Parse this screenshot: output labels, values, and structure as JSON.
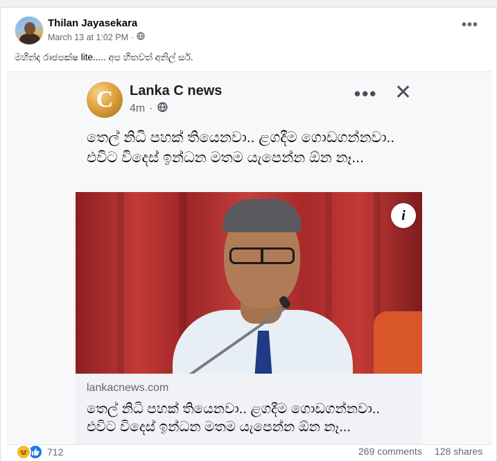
{
  "post": {
    "author": "Thilan Jayasekara",
    "timestamp": "March 13 at 1:02 PM",
    "separator": "·",
    "privacy_icon": "globe-icon",
    "text": "මහින්ද රාජපක්ෂ lite..... අප හිතවත් අනිල් සර්.",
    "more_label": "•••"
  },
  "shared_screenshot": {
    "page_name": "Lanka C news",
    "logo_letter": "C",
    "time": "4m",
    "dots": "•••",
    "close": "✕",
    "headline": "තෙල් නිධි පහක් තියෙනවා.. ළගදීම ගොඩගන්නවා.. එවිට විදෙස් ඉන්ධන මතම යැපෙන්න ඕන නෑ...",
    "info_label": "i",
    "link_domain": "lankacnews.com",
    "link_title": "තෙල් නිධි පහක් තියෙනවා.. ළගදීම ගොඩගන්නවා.. එවිට විදෙස් ඉන්ධන මතම යැපෙන්න ඕන නෑ..."
  },
  "footer": {
    "reaction_icons": [
      "haha-icon",
      "like-icon"
    ],
    "reaction_count": "712",
    "comments": "269 comments",
    "shares": "128 shares"
  },
  "colors": {
    "background": "#f0f2f5",
    "card": "#ffffff",
    "secondary_text": "#65676b",
    "like_blue": "#1877f2",
    "haha_yellow": "#f7b928"
  }
}
